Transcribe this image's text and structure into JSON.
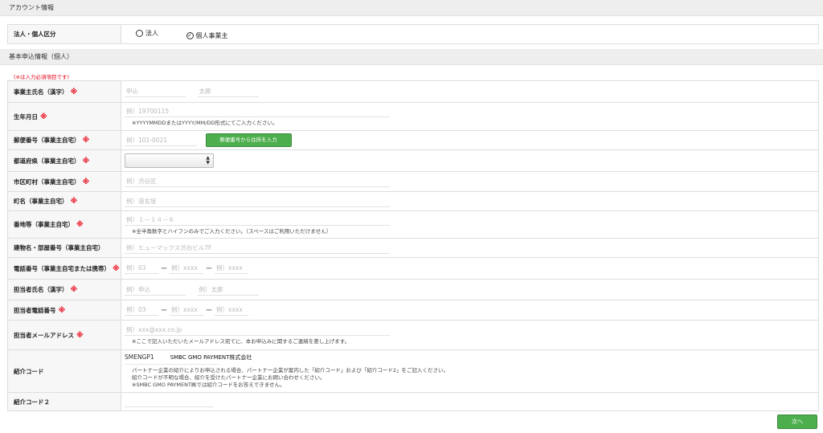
{
  "sections": {
    "account": "アカウント情報",
    "basic": "基本申込情報（個人）"
  },
  "account": {
    "type_label": "法人・個人区分",
    "options": [
      {
        "label": "法人",
        "checked": false
      },
      {
        "label": "個人事業主",
        "checked": true
      }
    ]
  },
  "required_note": "(※は入力必須項目です)",
  "required_mark": "※",
  "fields": {
    "name": {
      "label": "事業主氏名（漢字）",
      "placeholder_sei": "申込",
      "placeholder_mei": "太郎"
    },
    "birthdate": {
      "label": "生年月日",
      "placeholder": "例）19700115",
      "note": "※YYYYMMDDまたはYYYY/MM/DD形式にてご入力ください。"
    },
    "postal": {
      "label": "郵便番号（事業主自宅）",
      "placeholder": "例）101-0021",
      "button": "郵便番号から住所を入力"
    },
    "prefecture": {
      "label": "都道府県（事業主自宅）",
      "value": ""
    },
    "city": {
      "label": "市区町村（事業主自宅）",
      "placeholder": "例）渋谷区"
    },
    "town": {
      "label": "町名（事業主自宅）",
      "placeholder": "例）道玄坂"
    },
    "address": {
      "label": "番地等（事業主自宅）",
      "placeholder": "例）１－１４－６",
      "note": "※全半角数字とハイフンのみでご入力ください。（スペースはご利用いただけません）"
    },
    "building": {
      "label": "建物名・部屋番号（事業主自宅）",
      "placeholder": "例）ヒューマックス渋谷ビル7F"
    },
    "phone": {
      "label": "電話番号（事業主自宅または携帯）",
      "p1": "例）03",
      "p2": "例）xxxx",
      "p3": "例）xxxx",
      "dash": "ー"
    },
    "contact_name": {
      "label": "担当者氏名（漢字）",
      "placeholder_sei": "例）申込",
      "placeholder_mei": "例）太郎"
    },
    "contact_phone": {
      "label": "担当者電話番号",
      "p1": "例）03",
      "p2": "例）xxxx",
      "p3": "例）xxxx",
      "dash": "ー"
    },
    "contact_email": {
      "label": "担当者メールアドレス",
      "placeholder": "例）xxx@xxx.co.jp",
      "note": "※ここで記入いただいたメールアドレス宛てに、本お申込みに関するご連絡を差し上げます。"
    },
    "referral": {
      "label": "紹介コード",
      "code": "SMENGP1",
      "company": "SMBC GMO PAYMENT株式会社",
      "note1": "パートナー企業の紹介によりお申込される場合、パートナー企業が案内した「紹介コード」および「紹介コード2」をご記入ください。",
      "note2": "紹介コードが不明な場合、紹介を受けたパートナー企業にお問い合わせください。",
      "note3": "※SMBC GMO PAYMENT㈱では紹介コードをお答えできません。"
    },
    "referral2": {
      "label": "紹介コード２"
    }
  },
  "next_button": "次へ",
  "colors": {
    "accent_green": "#4cae4c",
    "required_red": "#e60012",
    "header_gray": "#eeeeee"
  }
}
